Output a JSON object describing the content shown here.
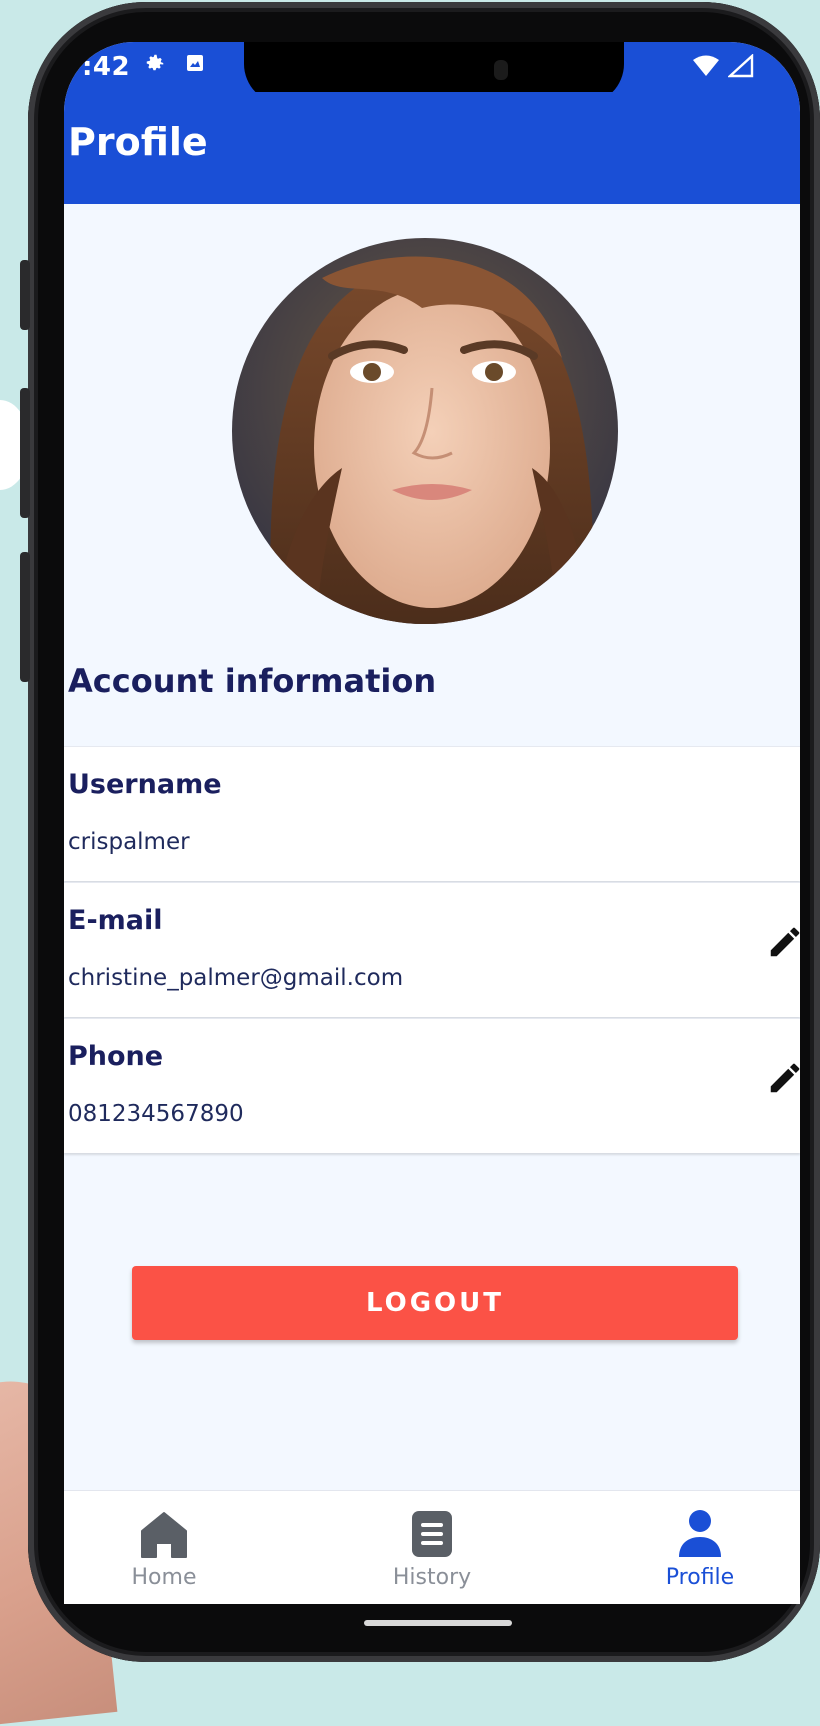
{
  "status_bar": {
    "time": ":42"
  },
  "app_bar": {
    "title": "Profile"
  },
  "account": {
    "section_title": "Account information",
    "fields": [
      {
        "label": "Username",
        "value": "crispalmer"
      },
      {
        "label": "E-mail",
        "value": "christine_palmer@gmail.com"
      },
      {
        "label": "Phone",
        "value": "081234567890"
      }
    ]
  },
  "logout_label": "LOGOUT",
  "bottom_nav": [
    {
      "label": "Home",
      "icon": "home-icon",
      "active": false
    },
    {
      "label": "History",
      "icon": "history-icon",
      "active": false
    },
    {
      "label": "Profile",
      "icon": "profile-icon",
      "active": true
    }
  ],
  "colors": {
    "primary": "#1a4fd6",
    "logout": "#fb5246",
    "background": "#f3f8ff",
    "text_dark": "#1a1f5e"
  }
}
